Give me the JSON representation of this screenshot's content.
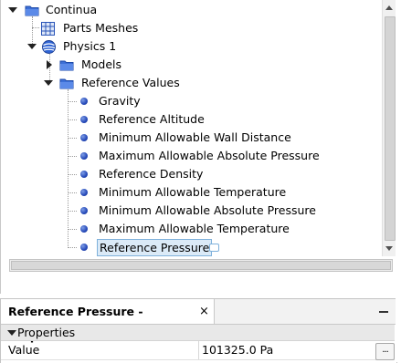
{
  "tree": {
    "nodes": [
      {
        "label": "Continua",
        "icon": "folder-icon",
        "state": "expanded"
      },
      {
        "label": "Parts Meshes",
        "icon": "grid-icon",
        "state": "leaf"
      },
      {
        "label": "Physics 1",
        "icon": "globe-icon",
        "state": "expanded"
      },
      {
        "label": "Models",
        "icon": "folder-icon",
        "state": "collapsed"
      },
      {
        "label": "Reference Values",
        "icon": "folder-icon",
        "state": "expanded"
      },
      {
        "label": "Gravity",
        "icon": "bullet-icon",
        "state": "leaf"
      },
      {
        "label": "Reference Altitude",
        "icon": "bullet-icon",
        "state": "leaf"
      },
      {
        "label": "Minimum Allowable Wall Distance",
        "icon": "bullet-icon",
        "state": "leaf"
      },
      {
        "label": "Maximum Allowable Absolute Pressure",
        "icon": "bullet-icon",
        "state": "leaf"
      },
      {
        "label": "Reference Density",
        "icon": "bullet-icon",
        "state": "leaf"
      },
      {
        "label": "Minimum Allowable Temperature",
        "icon": "bullet-icon",
        "state": "leaf"
      },
      {
        "label": "Minimum Allowable Absolute Pressure",
        "icon": "bullet-icon",
        "state": "leaf"
      },
      {
        "label": "Maximum Allowable Temperature",
        "icon": "bullet-icon",
        "state": "leaf"
      },
      {
        "label": "Reference Pressure",
        "icon": "bullet-icon",
        "state": "selected"
      }
    ]
  },
  "properties": {
    "tab_title": "Reference Pressure - Properties",
    "close_glyph": "×",
    "section_label": "Properties",
    "rows": [
      {
        "name": "Value",
        "value": "101325.0 Pa",
        "button_label": "..."
      }
    ]
  },
  "colors": {
    "bullet": "#2448b8",
    "folder": "#3c6fd6",
    "selection_bg": "#dbeaf7",
    "selection_border": "#7fb1db"
  }
}
